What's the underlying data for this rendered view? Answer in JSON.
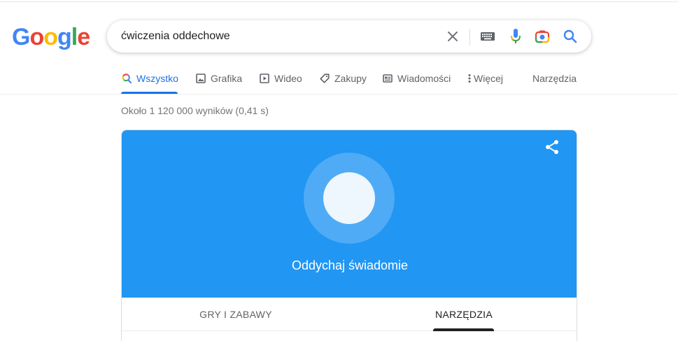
{
  "logo": {
    "letters": [
      "G",
      "o",
      "o",
      "g",
      "l",
      "e"
    ],
    "colors": [
      "#4285F4",
      "#EA4335",
      "#FBBC05",
      "#4285F4",
      "#34A853",
      "#EA4335"
    ]
  },
  "search": {
    "query": "ćwiczenia oddechowe"
  },
  "icons": {
    "clear": "close-icon",
    "keyboard": "keyboard-icon",
    "voice": "microphone-icon",
    "lens": "camera-icon",
    "search": "search-icon"
  },
  "tabs": [
    {
      "label": "Wszystko",
      "icon": "search-icon",
      "active": true
    },
    {
      "label": "Grafika",
      "icon": "image-icon"
    },
    {
      "label": "Wideo",
      "icon": "video-icon"
    },
    {
      "label": "Zakupy",
      "icon": "tag-icon"
    },
    {
      "label": "Wiadomości",
      "icon": "news-icon"
    },
    {
      "label": "Więcej",
      "icon": "more-vert-icon"
    }
  ],
  "tools": "Narzędzia",
  "results_stats": "Około 1 120 000 wyników (0,41 s)",
  "breathing_card": {
    "label": "Oddychaj świadomie",
    "tabs": [
      "GRY I ZABAWY",
      "NARZĘDZIA"
    ],
    "active_tab": "NARZĘDZIA",
    "hero_color": "#2196F3"
  },
  "colors": {
    "accent": "#1a73e8"
  }
}
